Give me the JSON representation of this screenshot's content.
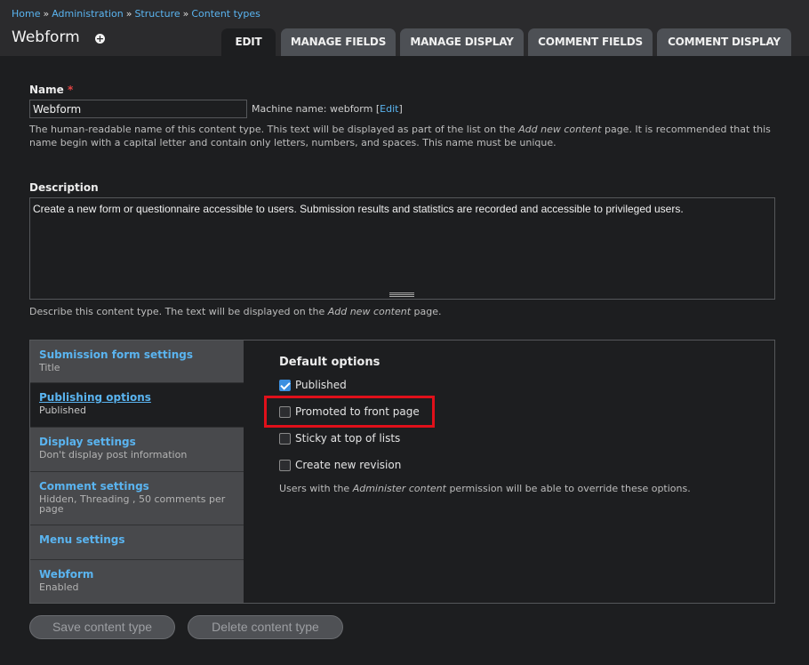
{
  "breadcrumb": [
    {
      "label": "Home"
    },
    {
      "label": "Administration"
    },
    {
      "label": "Structure"
    },
    {
      "label": "Content types"
    }
  ],
  "breadcrumb_separator": "»",
  "page_title": "Webform",
  "shortcut_icon": "plus-circle-icon",
  "tabs": [
    {
      "label": "EDIT",
      "active": true
    },
    {
      "label": "MANAGE FIELDS"
    },
    {
      "label": "MANAGE DISPLAY"
    },
    {
      "label": "COMMENT FIELDS"
    },
    {
      "label": "COMMENT DISPLAY"
    }
  ],
  "name_field": {
    "label": "Name",
    "required_mark": "*",
    "value": "Webform",
    "machine_name_prefix": "Machine name: webform",
    "machine_name_edit": "Edit",
    "help_prefix": "The human-readable name of this content type. This text will be displayed as part of the list on the ",
    "help_em": "Add new content",
    "help_suffix": " page. It is recommended that this name begin with a capital letter and contain only letters, numbers, and spaces. This name must be unique."
  },
  "description_field": {
    "label": "Description",
    "value": "Create a new form or questionnaire accessible to users. Submission results and statistics are recorded and accessible to privileged users.",
    "help_prefix": "Describe this content type. The text will be displayed on the ",
    "help_em": "Add new content",
    "help_suffix": " page."
  },
  "vertical_tabs": [
    {
      "title": "Submission form settings",
      "summary": "Title"
    },
    {
      "title": "Publishing options",
      "summary": "Published",
      "active": true
    },
    {
      "title": "Display settings",
      "summary": "Don't display post information"
    },
    {
      "title": "Comment settings",
      "summary": "Hidden, Threading , 50 comments per page"
    },
    {
      "title": "Menu settings",
      "summary": ""
    },
    {
      "title": "Webform",
      "summary": "Enabled"
    }
  ],
  "publishing": {
    "title": "Default options",
    "options": [
      {
        "label": "Published",
        "checked": true
      },
      {
        "label": "Promoted to front page",
        "checked": false
      },
      {
        "label": "Sticky at top of lists",
        "checked": false
      },
      {
        "label": "Create new revision",
        "checked": false
      }
    ],
    "help_prefix": "Users with the ",
    "help_em": "Administer content",
    "help_suffix": " permission will be able to override these options."
  },
  "buttons": {
    "save": "Save content type",
    "delete": "Delete content type"
  },
  "colors": {
    "link": "#5ab4f0",
    "highlight": "#e0101a",
    "checkbox_checked": "#3b8fe0"
  }
}
